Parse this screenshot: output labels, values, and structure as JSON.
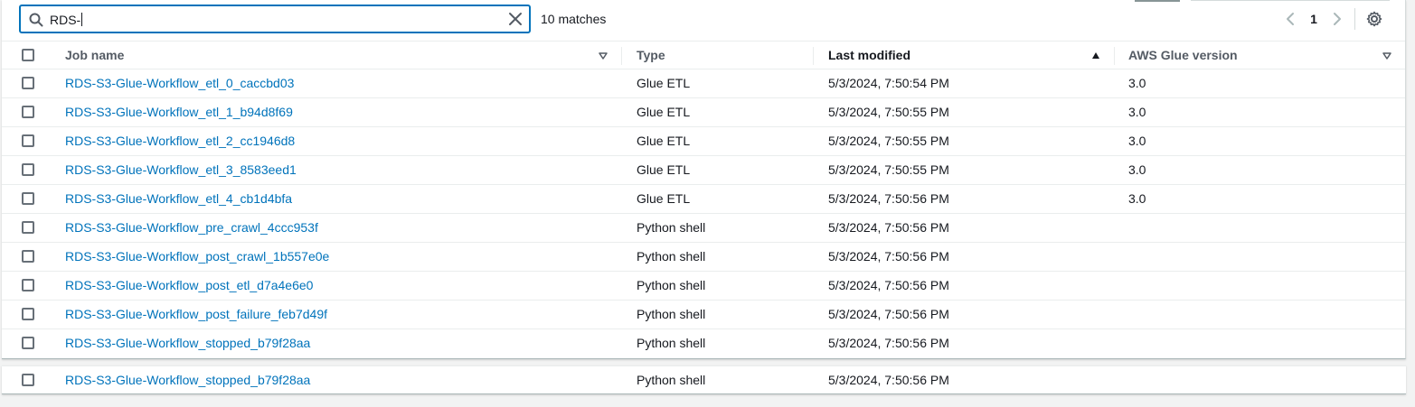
{
  "search": {
    "value": "RDS-",
    "matches": "10 matches"
  },
  "pagination": {
    "current_page": "1"
  },
  "columns": {
    "job_name": "Job name",
    "type": "Type",
    "last_modified": "Last modified",
    "glue_version": "AWS Glue version"
  },
  "rows": [
    {
      "name": "RDS-S3-Glue-Workflow_etl_0_caccbd03",
      "type": "Glue ETL",
      "modified": "5/3/2024, 7:50:54 PM",
      "version": "3.0"
    },
    {
      "name": "RDS-S3-Glue-Workflow_etl_1_b94d8f69",
      "type": "Glue ETL",
      "modified": "5/3/2024, 7:50:55 PM",
      "version": "3.0"
    },
    {
      "name": "RDS-S3-Glue-Workflow_etl_2_cc1946d8",
      "type": "Glue ETL",
      "modified": "5/3/2024, 7:50:55 PM",
      "version": "3.0"
    },
    {
      "name": "RDS-S3-Glue-Workflow_etl_3_8583eed1",
      "type": "Glue ETL",
      "modified": "5/3/2024, 7:50:55 PM",
      "version": "3.0"
    },
    {
      "name": "RDS-S3-Glue-Workflow_etl_4_cb1d4bfa",
      "type": "Glue ETL",
      "modified": "5/3/2024, 7:50:56 PM",
      "version": "3.0"
    },
    {
      "name": "RDS-S3-Glue-Workflow_pre_crawl_4ccc953f",
      "type": "Python shell",
      "modified": "5/3/2024, 7:50:56 PM",
      "version": ""
    },
    {
      "name": "RDS-S3-Glue-Workflow_post_crawl_1b557e0e",
      "type": "Python shell",
      "modified": "5/3/2024, 7:50:56 PM",
      "version": ""
    },
    {
      "name": "RDS-S3-Glue-Workflow_post_etl_d7a4e6e0",
      "type": "Python shell",
      "modified": "5/3/2024, 7:50:56 PM",
      "version": ""
    },
    {
      "name": "RDS-S3-Glue-Workflow_post_failure_feb7d49f",
      "type": "Python shell",
      "modified": "5/3/2024, 7:50:56 PM",
      "version": ""
    },
    {
      "name": "RDS-S3-Glue-Workflow_stopped_b79f28aa",
      "type": "Python shell",
      "modified": "5/3/2024, 7:50:56 PM",
      "version": ""
    }
  ],
  "extra_row": {
    "name": "RDS-S3-Glue-Workflow_stopped_b79f28aa",
    "type": "Python shell",
    "modified": "5/3/2024, 7:50:56 PM",
    "version": ""
  }
}
